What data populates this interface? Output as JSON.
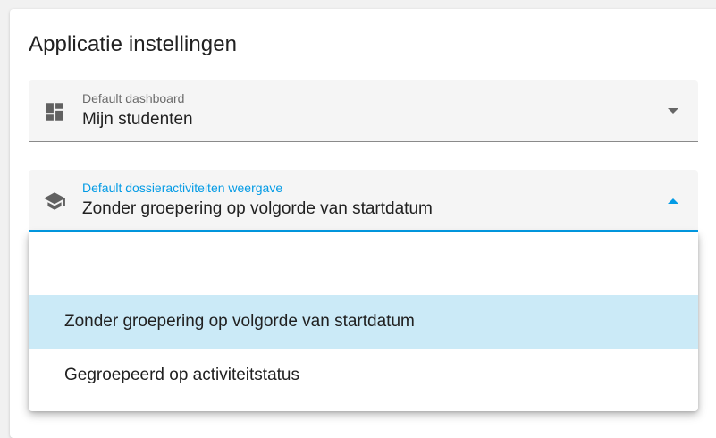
{
  "card": {
    "title": "Applicatie instellingen"
  },
  "dashboard_field": {
    "label": "Default dashboard",
    "value": "Mijn studenten",
    "icon": "dashboard-icon"
  },
  "dossier_field": {
    "label": "Default dossieractiviteiten weergave",
    "value": "Zonder groepering op volgorde van startdatum",
    "icon": "school-icon"
  },
  "dropdown": {
    "options": [
      {
        "label": ""
      },
      {
        "label": "Zonder groepering op volgorde van startdatum"
      },
      {
        "label": "Gegroepeerd op activiteitstatus"
      }
    ]
  },
  "colors": {
    "accent": "#039be5",
    "selected_option_bg": "#cbeaf7",
    "field_bg": "#f5f5f5"
  }
}
